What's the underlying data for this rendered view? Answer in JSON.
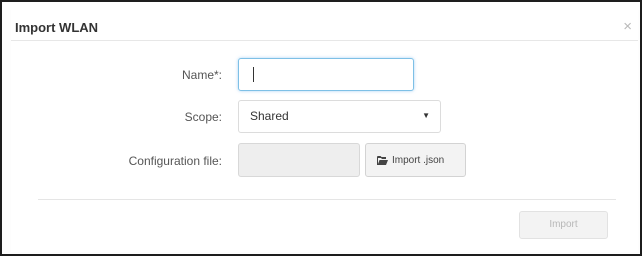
{
  "dialog": {
    "title": "Import WLAN",
    "close_label": "×"
  },
  "form": {
    "name": {
      "label": "Name*:",
      "value": ""
    },
    "scope": {
      "label": "Scope:",
      "selected": "Shared",
      "caret": "▼"
    },
    "config_file": {
      "label": "Configuration file:",
      "value": "",
      "button_label": "Import .json",
      "button_icon": "folder-open-icon"
    }
  },
  "footer": {
    "import_label": "Import",
    "import_disabled": true
  },
  "colors": {
    "focus_border": "#7ec0e6",
    "disabled_text": "#b8b8b8",
    "title_text": "#333333"
  }
}
